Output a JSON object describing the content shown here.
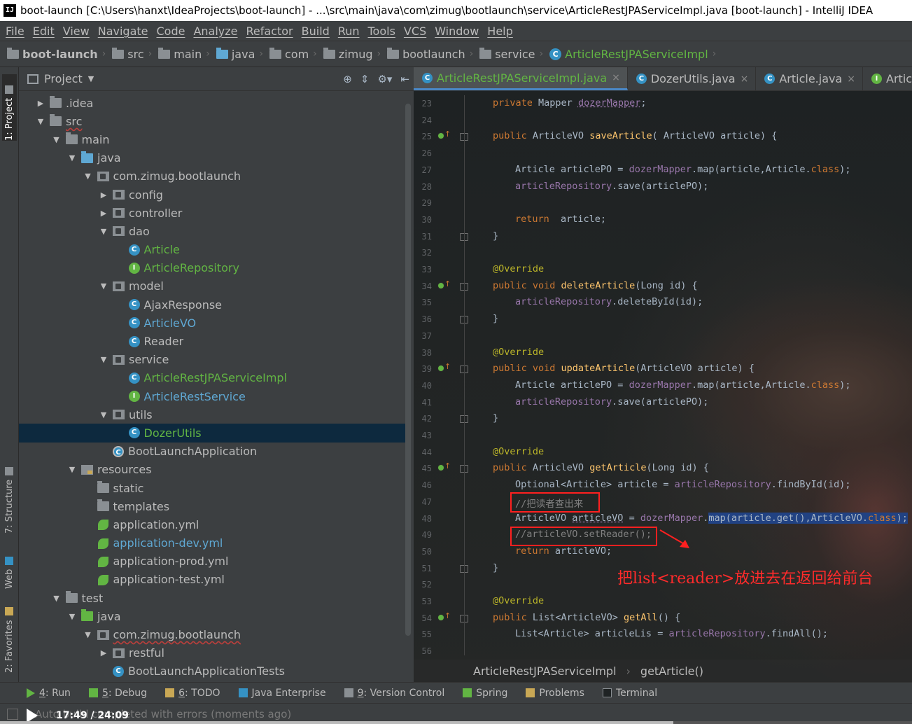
{
  "window": {
    "title": "boot-launch [C:\\Users\\hanxt\\IdeaProjects\\boot-launch] - ...\\src\\main\\java\\com\\zimug\\bootlaunch\\service\\ArticleRestJPAServiceImpl.java [boot-launch] - IntelliJ IDEA",
    "app_icon": "IJ"
  },
  "menu": [
    "File",
    "Edit",
    "View",
    "Navigate",
    "Code",
    "Analyze",
    "Refactor",
    "Build",
    "Run",
    "Tools",
    "VCS",
    "Window",
    "Help"
  ],
  "breadcrumb": [
    "boot-launch",
    "src",
    "main",
    "java",
    "com",
    "zimug",
    "bootlaunch",
    "service",
    "ArticleRestJPAServiceImpl"
  ],
  "left_stripe": {
    "project": "1: Project",
    "structure": "7: Structure",
    "web": "Web",
    "favorites": "2: Favorites"
  },
  "project_panel": {
    "title": "Project",
    "tree": [
      {
        "label": ".idea",
        "icon": "folder-icon",
        "level": 1,
        "arrow": "collapsed"
      },
      {
        "label": "src",
        "icon": "folder-icon",
        "level": 1,
        "arrow": "expanded",
        "wavy": true
      },
      {
        "label": "main",
        "icon": "folder-icon",
        "level": 2,
        "arrow": "expanded"
      },
      {
        "label": "java",
        "icon": "source-folder-icon",
        "level": 3,
        "arrow": "expanded"
      },
      {
        "label": "com.zimug.bootlaunch",
        "icon": "package-icon",
        "level": 4,
        "arrow": "expanded"
      },
      {
        "label": "config",
        "icon": "package-icon",
        "level": 5,
        "arrow": "collapsed"
      },
      {
        "label": "controller",
        "icon": "package-icon",
        "level": 5,
        "arrow": "collapsed"
      },
      {
        "label": "dao",
        "icon": "package-icon",
        "level": 5,
        "arrow": "expanded"
      },
      {
        "label": "Article",
        "icon": "class-icon",
        "level": 6,
        "color": "green"
      },
      {
        "label": "ArticleRepository",
        "icon": "interface-icon",
        "level": 6,
        "color": "green"
      },
      {
        "label": "model",
        "icon": "package-icon",
        "level": 5,
        "arrow": "expanded"
      },
      {
        "label": "AjaxResponse",
        "icon": "class-icon",
        "level": 6
      },
      {
        "label": "ArticleVO",
        "icon": "class-icon",
        "level": 6,
        "color": "blue"
      },
      {
        "label": "Reader",
        "icon": "class-icon",
        "level": 6
      },
      {
        "label": "service",
        "icon": "package-icon",
        "level": 5,
        "arrow": "expanded"
      },
      {
        "label": "ArticleRestJPAServiceImpl",
        "icon": "class-icon",
        "level": 6,
        "color": "green"
      },
      {
        "label": "ArticleRestService",
        "icon": "interface-icon",
        "level": 6,
        "color": "blue"
      },
      {
        "label": "utils",
        "icon": "package-icon",
        "level": 5,
        "arrow": "expanded"
      },
      {
        "label": "DozerUtils",
        "icon": "class-icon",
        "level": 6,
        "color": "green",
        "selected": true
      },
      {
        "label": "BootLaunchApplication",
        "icon": "app-icon",
        "level": 5
      },
      {
        "label": "resources",
        "icon": "resources-folder-icon",
        "level": 3,
        "arrow": "expanded"
      },
      {
        "label": "static",
        "icon": "folder-icon",
        "level": 4
      },
      {
        "label": "templates",
        "icon": "folder-icon",
        "level": 4
      },
      {
        "label": "application.yml",
        "icon": "yaml-icon",
        "level": 4
      },
      {
        "label": "application-dev.yml",
        "icon": "yaml-icon",
        "level": 4,
        "color": "blue"
      },
      {
        "label": "application-prod.yml",
        "icon": "yaml-icon",
        "level": 4
      },
      {
        "label": "application-test.yml",
        "icon": "yaml-icon",
        "level": 4
      },
      {
        "label": "test",
        "icon": "folder-icon",
        "level": 2,
        "arrow": "expanded"
      },
      {
        "label": "java",
        "icon": "test-folder-icon",
        "level": 3,
        "arrow": "expanded"
      },
      {
        "label": "com.zimug.bootlaunch",
        "icon": "package-icon",
        "level": 4,
        "arrow": "expanded",
        "wavy": true
      },
      {
        "label": "restful",
        "icon": "package-icon",
        "level": 5,
        "arrow": "collapsed"
      },
      {
        "label": "BootLaunchApplicationTests",
        "icon": "class-icon",
        "level": 5
      }
    ]
  },
  "editor": {
    "tabs": [
      {
        "label": "ArticleRestJPAServiceImpl.java",
        "icon": "class-icon",
        "active": true
      },
      {
        "label": "DozerUtils.java",
        "icon": "class-icon"
      },
      {
        "label": "Article.java",
        "icon": "class-icon"
      },
      {
        "label": "ArticleRepo",
        "icon": "interface-icon"
      }
    ],
    "lines": [
      {
        "n": "23",
        "tokens": [
          [
            "kw",
            "private "
          ],
          [
            "",
            "Mapper "
          ],
          [
            "fld squig",
            "dozerMapper"
          ],
          [
            "",
            ";"
          ]
        ],
        "indent": 0
      },
      {
        "n": "24",
        "tokens": [],
        "indent": 0
      },
      {
        "n": "25",
        "tokens": [
          [
            "kw",
            "public "
          ],
          [
            "",
            "ArticleVO "
          ],
          [
            "fn",
            "saveArticle"
          ],
          [
            "",
            "( ArticleVO article) {"
          ]
        ],
        "indent": 0,
        "mark": true,
        "fold": true
      },
      {
        "n": "26",
        "tokens": [],
        "indent": 0
      },
      {
        "n": "27",
        "tokens": [
          [
            "",
            "Article articlePO = "
          ],
          [
            "fld",
            "dozerMapper"
          ],
          [
            "",
            ".map(article,Article."
          ],
          [
            "kw",
            "class"
          ],
          [
            "",
            ");"
          ]
        ],
        "indent": 1
      },
      {
        "n": "28",
        "tokens": [
          [
            "fld",
            "articleRepository"
          ],
          [
            "",
            ".save(articlePO);"
          ]
        ],
        "indent": 1
      },
      {
        "n": "29",
        "tokens": [],
        "indent": 0
      },
      {
        "n": "30",
        "tokens": [
          [
            "kw",
            "return  "
          ],
          [
            "",
            "article;"
          ]
        ],
        "indent": 1
      },
      {
        "n": "31",
        "tokens": [
          [
            "",
            "}"
          ]
        ],
        "indent": 0,
        "fold": true
      },
      {
        "n": "32",
        "tokens": [],
        "indent": 0
      },
      {
        "n": "33",
        "tokens": [
          [
            "an",
            "@Override"
          ]
        ],
        "indent": 0
      },
      {
        "n": "34",
        "tokens": [
          [
            "kw",
            "public void "
          ],
          [
            "fn",
            "deleteArticle"
          ],
          [
            "",
            "(Long id) {"
          ]
        ],
        "indent": 0,
        "mark": true,
        "fold": true
      },
      {
        "n": "35",
        "tokens": [
          [
            "fld",
            "articleRepository"
          ],
          [
            "",
            ".deleteById(id);"
          ]
        ],
        "indent": 1
      },
      {
        "n": "36",
        "tokens": [
          [
            "",
            "}"
          ]
        ],
        "indent": 0,
        "fold": true
      },
      {
        "n": "37",
        "tokens": [],
        "indent": 0
      },
      {
        "n": "38",
        "tokens": [
          [
            "an",
            "@Override"
          ]
        ],
        "indent": 0
      },
      {
        "n": "39",
        "tokens": [
          [
            "kw",
            "public void "
          ],
          [
            "fn",
            "updateArticle"
          ],
          [
            "",
            "(ArticleVO article) {"
          ]
        ],
        "indent": 0,
        "mark": true,
        "fold": true
      },
      {
        "n": "40",
        "tokens": [
          [
            "",
            "Article articlePO = "
          ],
          [
            "fld",
            "dozerMapper"
          ],
          [
            "",
            ".map(article,Article."
          ],
          [
            "kw",
            "class"
          ],
          [
            "",
            ");"
          ]
        ],
        "indent": 1
      },
      {
        "n": "41",
        "tokens": [
          [
            "fld",
            "articleRepository"
          ],
          [
            "",
            ".save(articlePO);"
          ]
        ],
        "indent": 1
      },
      {
        "n": "42",
        "tokens": [
          [
            "",
            "}"
          ]
        ],
        "indent": 0,
        "fold": true
      },
      {
        "n": "43",
        "tokens": [],
        "indent": 0
      },
      {
        "n": "44",
        "tokens": [
          [
            "an",
            "@Override"
          ]
        ],
        "indent": 0
      },
      {
        "n": "45",
        "tokens": [
          [
            "kw",
            "public "
          ],
          [
            "",
            "ArticleVO "
          ],
          [
            "fn",
            "getArticle"
          ],
          [
            "",
            "(Long id) {"
          ]
        ],
        "indent": 0,
        "mark": true,
        "fold": true
      },
      {
        "n": "46",
        "tokens": [
          [
            "",
            "Optional<Article> article = "
          ],
          [
            "fld",
            "articleRepository"
          ],
          [
            "",
            ".findById(id);"
          ]
        ],
        "indent": 1
      },
      {
        "n": "47",
        "tokens": [
          [
            "cm",
            "//把读者查出来"
          ]
        ],
        "indent": 1
      },
      {
        "n": "48",
        "tokens": [
          [
            "",
            "ArticleVO "
          ],
          [
            "squig",
            "articleVO"
          ],
          [
            "",
            " = "
          ],
          [
            "fld",
            "dozerMapper"
          ],
          [
            "",
            "."
          ],
          [
            "sel",
            "map(article.get(),ArticleVO."
          ],
          [
            "sel kw",
            "class"
          ],
          [
            "sel",
            ");"
          ]
        ],
        "indent": 1
      },
      {
        "n": "49",
        "tokens": [
          [
            "cm",
            "//articleVO.setReader();"
          ]
        ],
        "indent": 1
      },
      {
        "n": "50",
        "tokens": [
          [
            "kw",
            "return "
          ],
          [
            "",
            "articleVO;"
          ]
        ],
        "indent": 1
      },
      {
        "n": "51",
        "tokens": [
          [
            "",
            "}"
          ]
        ],
        "indent": 0,
        "fold": true
      },
      {
        "n": "52",
        "tokens": [],
        "indent": 0
      },
      {
        "n": "53",
        "tokens": [
          [
            "an",
            "@Override"
          ]
        ],
        "indent": 0
      },
      {
        "n": "54",
        "tokens": [
          [
            "kw",
            "public "
          ],
          [
            "",
            "List<ArticleVO> "
          ],
          [
            "fn",
            "getAll"
          ],
          [
            "",
            "() {"
          ]
        ],
        "indent": 0,
        "mark": true,
        "fold": true
      },
      {
        "n": "55",
        "tokens": [
          [
            "",
            "List<Article> articleLis = "
          ],
          [
            "fld",
            "articleRepository"
          ],
          [
            "",
            ".findAll();"
          ]
        ],
        "indent": 1
      },
      {
        "n": "56",
        "tokens": [],
        "indent": 0
      }
    ],
    "annotation_text": "把list<reader>放进去在返回给前台",
    "breadcrumb": [
      "ArticleRestJPAServiceImpl",
      "getArticle()"
    ]
  },
  "bottom_tools": [
    {
      "num": "4",
      "label": ": Run",
      "icon": "run-icon",
      "color": "#62b543"
    },
    {
      "num": "5",
      "label": ": Debug",
      "icon": "debug-icon",
      "color": "#62b543"
    },
    {
      "num": "6",
      "label": ": TODO",
      "icon": "todo-icon",
      "color": "#c9a855"
    },
    {
      "num": "",
      "label": "Java Enterprise",
      "icon": "java-enterprise-icon",
      "color": "#3592c4"
    },
    {
      "num": "9",
      "label": ": Version Control",
      "icon": "vcs-icon",
      "color": "#8a8f93"
    },
    {
      "num": "",
      "label": "Spring",
      "icon": "spring-icon",
      "color": "#62b543"
    },
    {
      "num": "",
      "label": "Problems",
      "icon": "warning-icon",
      "color": "#c9a855"
    },
    {
      "num": "",
      "label": "Terminal",
      "icon": "terminal-icon",
      "color": "#1f2324"
    }
  ],
  "status": {
    "message": "Auto build completed with errors (moments ago)"
  },
  "video": {
    "time": "17:49 / 24:09",
    "progress": 0.738
  }
}
